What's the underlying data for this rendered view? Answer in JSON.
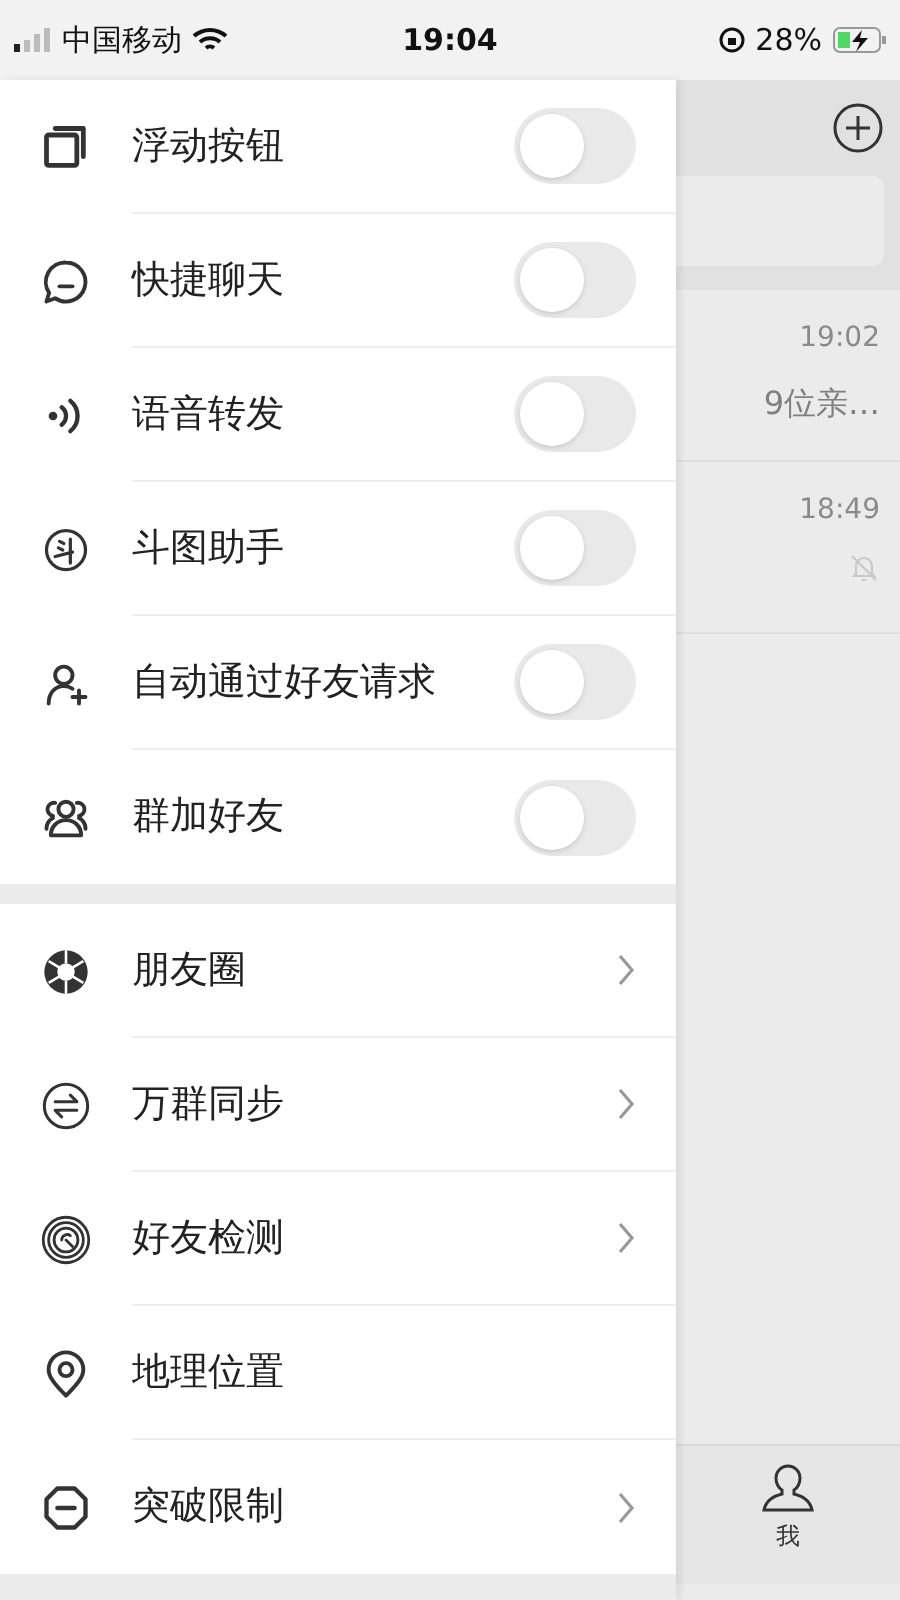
{
  "status_bar": {
    "carrier": "中国移动",
    "time": "19:04",
    "battery": "28%"
  },
  "menu_sections": [
    {
      "items": [
        {
          "kind": "toggle",
          "label": "浮动按钮",
          "on": false
        },
        {
          "kind": "toggle",
          "label": "快捷聊天",
          "on": false
        },
        {
          "kind": "toggle",
          "label": "语音转发",
          "on": false
        },
        {
          "kind": "toggle",
          "label": "斗图助手",
          "on": false
        },
        {
          "kind": "toggle",
          "label": "自动通过好友请求",
          "on": false
        },
        {
          "kind": "toggle",
          "label": "群加好友",
          "on": false
        }
      ]
    },
    {
      "items": [
        {
          "kind": "link",
          "label": "朋友圈",
          "chevron": true
        },
        {
          "kind": "link",
          "label": "万群同步",
          "chevron": true
        },
        {
          "kind": "link",
          "label": "好友检测",
          "chevron": true
        },
        {
          "kind": "link",
          "label": "地理位置",
          "chevron": false
        },
        {
          "kind": "link",
          "label": "突破限制",
          "chevron": true
        }
      ]
    }
  ],
  "background_chats": [
    {
      "time": "19:02",
      "preview": "9位亲…",
      "muted": false
    },
    {
      "time": "18:49",
      "muted": true
    }
  ],
  "tab_bar": {
    "label": "我"
  }
}
